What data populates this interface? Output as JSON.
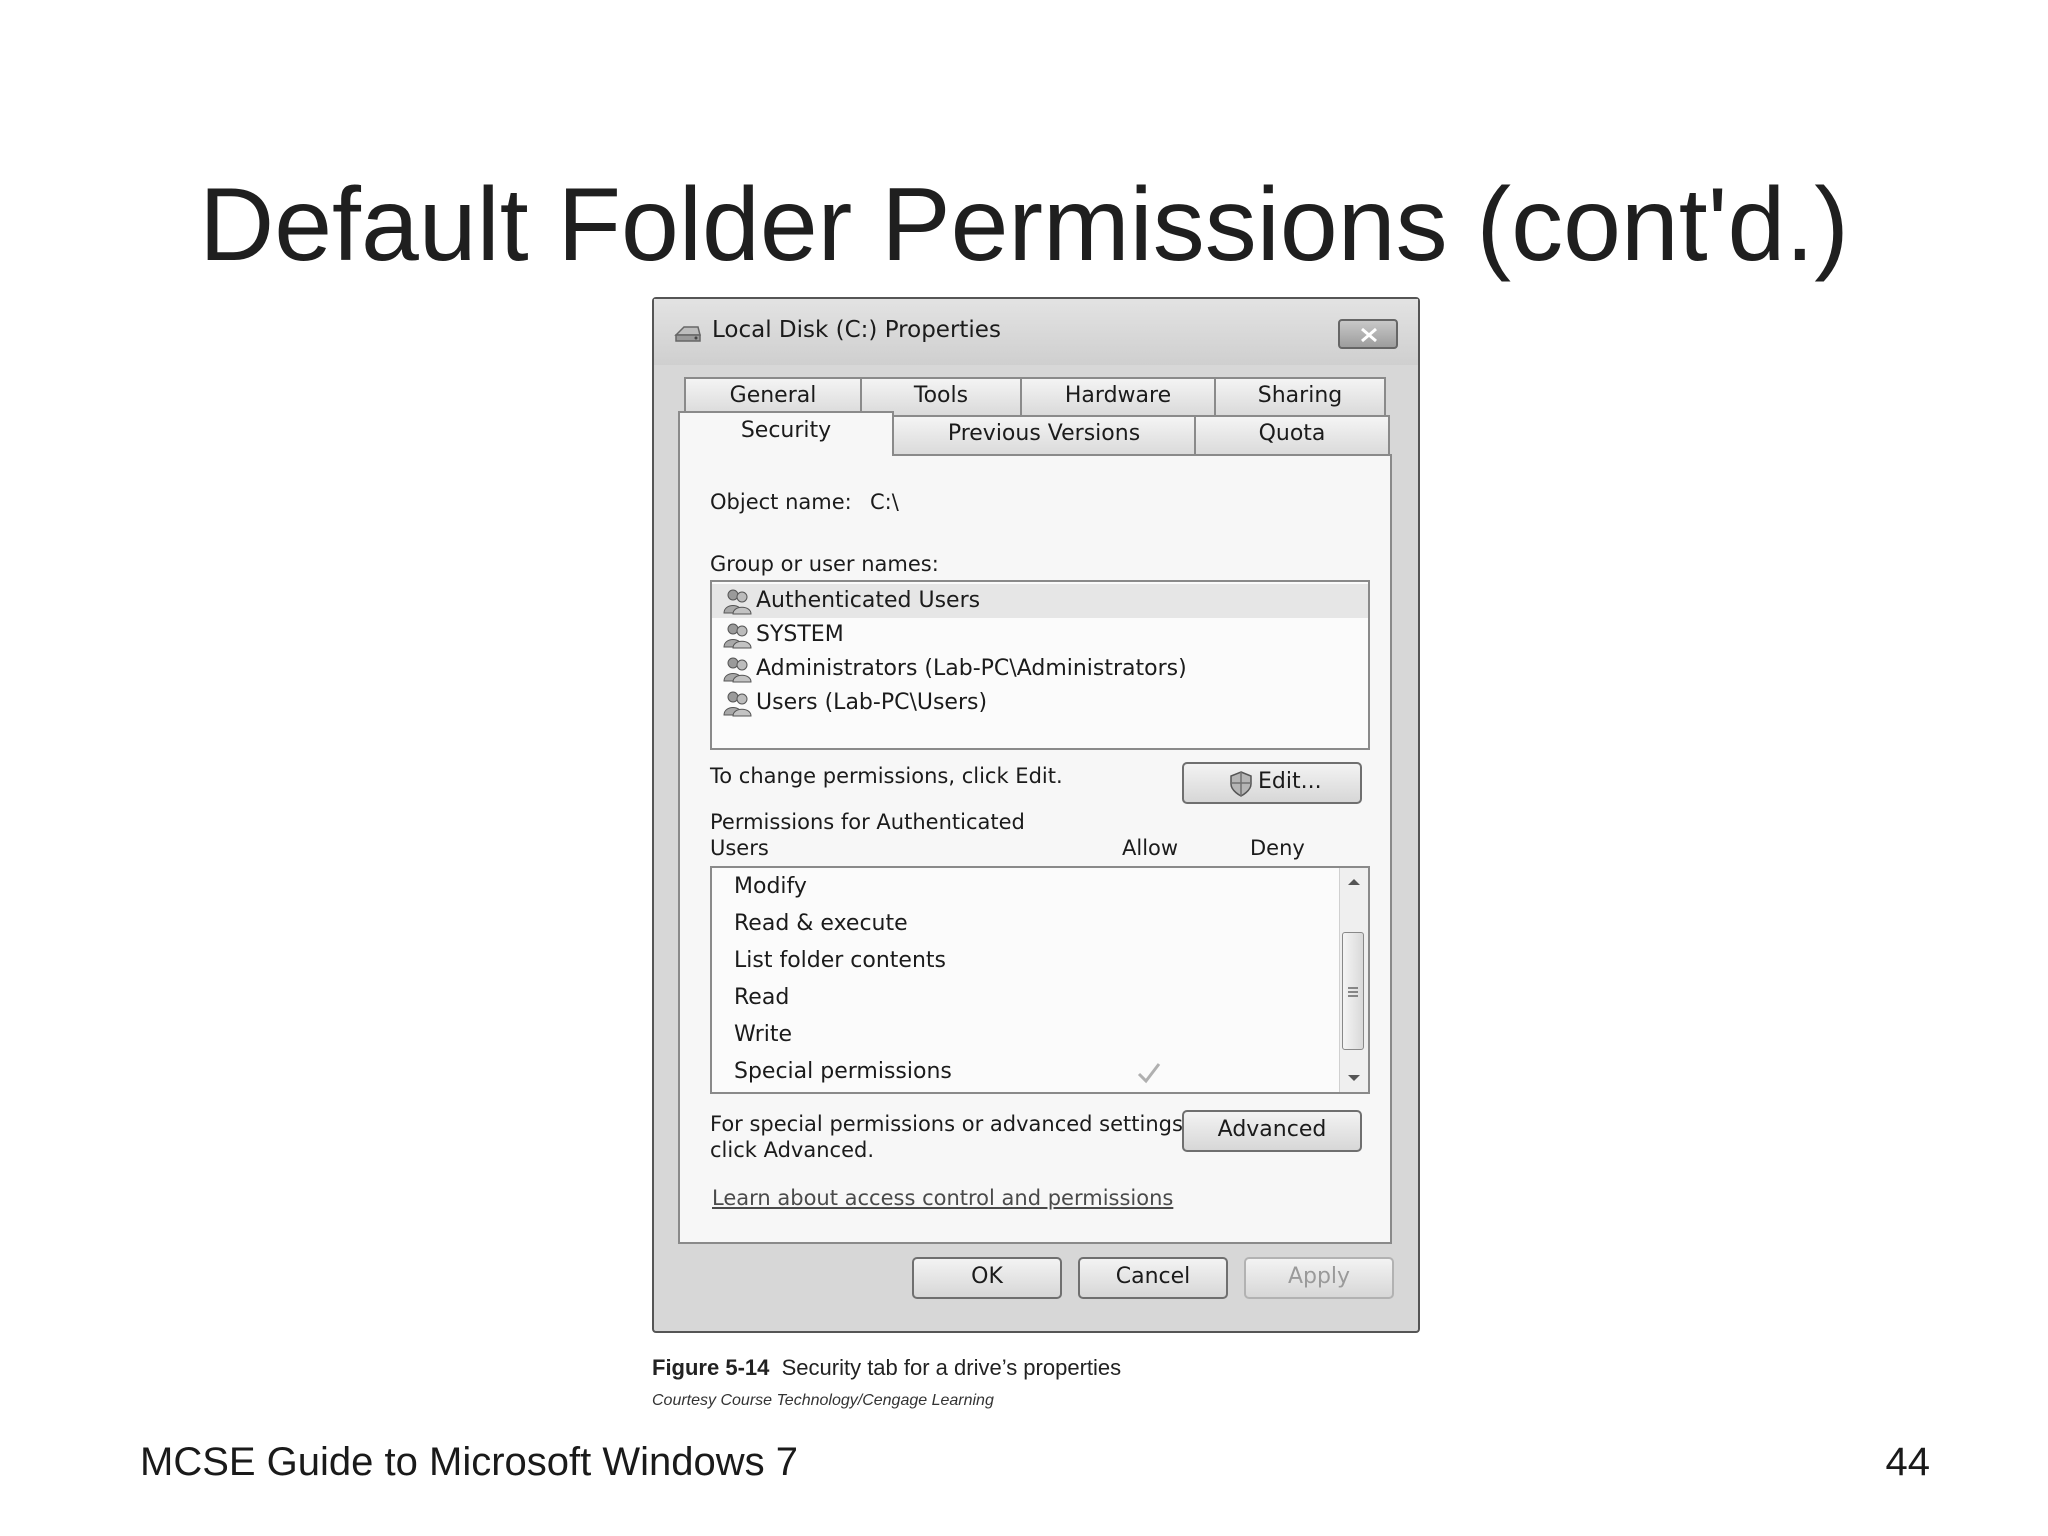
{
  "slide": {
    "title": "Default Folder Permissions (cont'd.)",
    "footer_left": "MCSE Guide to Microsoft Windows 7",
    "page_number": "44"
  },
  "dialog": {
    "title": "Local Disk (C:) Properties",
    "tabs_row1": [
      "General",
      "Tools",
      "Hardware",
      "Sharing"
    ],
    "tabs_row2": [
      "Security",
      "Previous Versions",
      "Quota"
    ],
    "active_tab": "Security",
    "object_name_label": "Object name:",
    "object_name_value": "C:\\",
    "group_label": "Group or user names:",
    "groups": [
      {
        "name": "Authenticated Users",
        "selected": true
      },
      {
        "name": "SYSTEM",
        "selected": false
      },
      {
        "name": "Administrators (Lab-PC\\Administrators)",
        "selected": false
      },
      {
        "name": "Users (Lab-PC\\Users)",
        "selected": false
      }
    ],
    "change_hint": "To change permissions, click Edit.",
    "edit_label": "Edit...",
    "permissions_label_line1": "Permissions for Authenticated",
    "permissions_label_line2": "Users",
    "allow_header": "Allow",
    "deny_header": "Deny",
    "permissions": [
      {
        "name": "Modify",
        "allow": false,
        "deny": false
      },
      {
        "name": "Read & execute",
        "allow": false,
        "deny": false
      },
      {
        "name": "List folder contents",
        "allow": false,
        "deny": false
      },
      {
        "name": "Read",
        "allow": false,
        "deny": false
      },
      {
        "name": "Write",
        "allow": false,
        "deny": false
      },
      {
        "name": "Special permissions",
        "allow": true,
        "deny": false
      }
    ],
    "advanced_hint_line1": "For special permissions or advanced settings,",
    "advanced_hint_line2": "click Advanced.",
    "advanced_label": "Advanced",
    "learn_link": "Learn about access control and permissions",
    "ok_label": "OK",
    "cancel_label": "Cancel",
    "apply_label": "Apply"
  },
  "figure": {
    "number": "Figure 5-14",
    "caption": "Security tab for a drive’s properties",
    "courtesy": "Courtesy Course Technology/Cengage Learning"
  }
}
